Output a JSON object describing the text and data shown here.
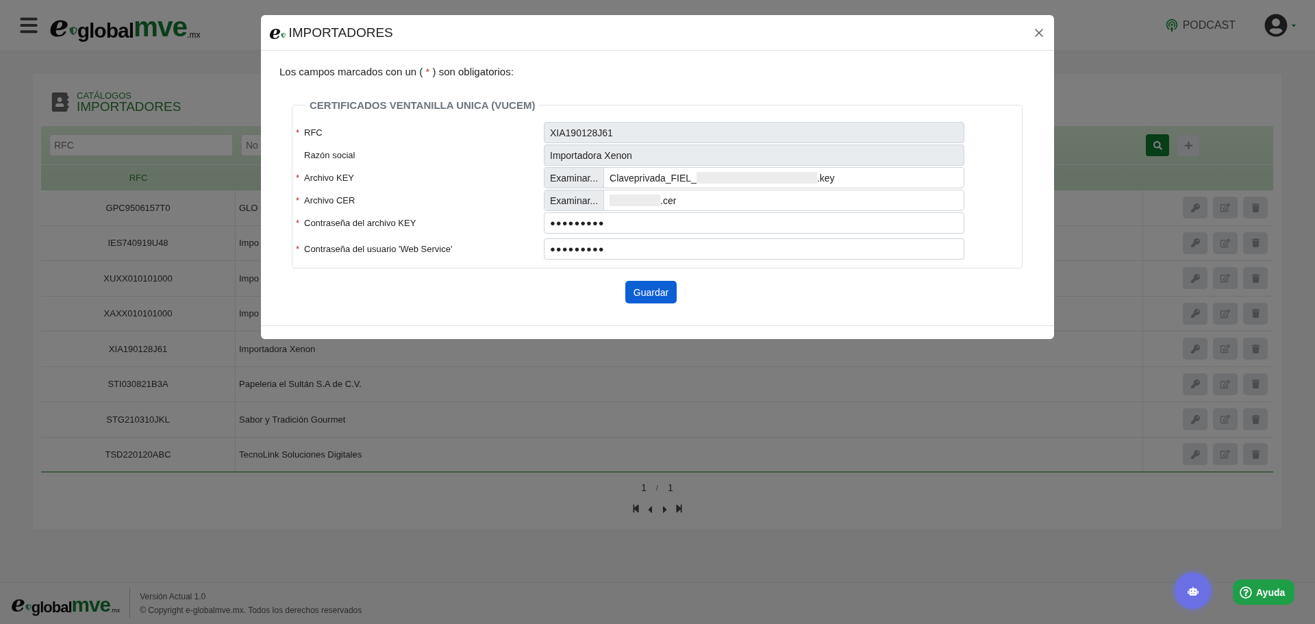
{
  "header": {
    "logo": {
      "initial": "e",
      "word": "global",
      "brand": "mve",
      "suffix": ".mx"
    },
    "podcast": "PODCAST"
  },
  "catalog": {
    "section": "CATÁLOGOS",
    "title": "IMPORTADORES"
  },
  "filters": [
    {
      "placeholder": "RFC"
    },
    {
      "placeholder": "No"
    }
  ],
  "table": {
    "columns": [
      "RFC"
    ],
    "rows": [
      {
        "rfc": "GPC9506157T0",
        "name": "GLO"
      },
      {
        "rfc": "IES740919U48",
        "name": "Impo"
      },
      {
        "rfc": "XUXX010101000",
        "name": "Impo"
      },
      {
        "rfc": "XAXX010101000",
        "name": "Impo"
      },
      {
        "rfc": "XIA190128J61",
        "name": "Importadora Xenon"
      },
      {
        "rfc": "STI030821B3A",
        "name": "Papeleria el Sultán S.A de C.V."
      },
      {
        "rfc": "STG210310JKL",
        "name": "Sabor y Tradición Gourmet"
      },
      {
        "rfc": "TSD220120ABC",
        "name": "TecnoLink Soluciones Digitales"
      }
    ]
  },
  "pagination": {
    "page": "1",
    "separator": "/",
    "total": "1"
  },
  "footer": {
    "logo": {
      "initial": "e",
      "word": "global",
      "brand": "mve",
      "suffix": ".mx"
    },
    "version": "Versión Actual 1.0",
    "copyright": "© Copyright e-globalmve.mx. Todos los derechos reservados"
  },
  "modal": {
    "logo_initial": "e",
    "title": "IMPORTADORES",
    "notice_start": "Los campos marcados con un (",
    "notice_mark": "*",
    "notice_end": ") son obligatorios:",
    "legend": "CERTIFICADOS VENTANILLA UNICA (VUCEM)",
    "fields": [
      {
        "kind": "text",
        "label": "RFC",
        "required": true,
        "readonly": true,
        "value": "XIA190128J61"
      },
      {
        "kind": "text",
        "label": "Razón social",
        "required": false,
        "readonly": true,
        "value": "Importadora Xenon"
      },
      {
        "kind": "file",
        "label": "Archivo KEY",
        "required": true,
        "button": "Examinar...",
        "prefix": "Claveprivada_FIEL_",
        "redacted": true,
        "suffix": ".key"
      },
      {
        "kind": "file",
        "label": "Archivo CER",
        "required": true,
        "button": "Examinar...",
        "redacted": true,
        "suffix": ".cer"
      },
      {
        "kind": "password",
        "label": "Contraseña del archivo KEY",
        "required": true,
        "value": "●●●●●●●●●"
      },
      {
        "kind": "password",
        "label": "Contraseña del usuario 'Web Service'",
        "required": true,
        "value": "●●●●●●●●●"
      }
    ],
    "submit": "Guardar"
  },
  "help": "Ayuda"
}
